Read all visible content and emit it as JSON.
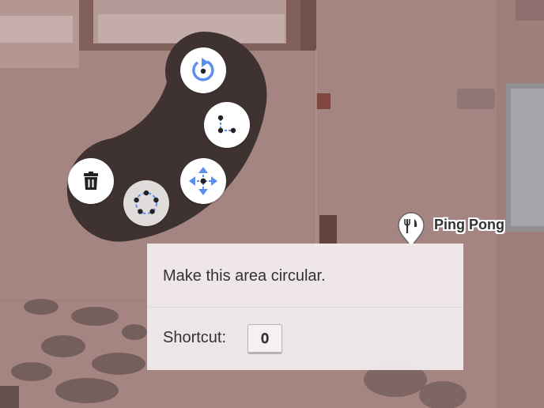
{
  "map": {
    "overlay_color": "#a68682",
    "poi": {
      "label": "Ping Pong",
      "icon": "restaurant-icon"
    }
  },
  "radial_menu": {
    "background_color": "#3e3331",
    "accent_color": "#5b8ff0",
    "items": [
      {
        "name": "rotate-button",
        "icon": "rotate-icon"
      },
      {
        "name": "disconnect-button",
        "icon": "disconnect-icon"
      },
      {
        "name": "move-button",
        "icon": "move-icon"
      },
      {
        "name": "circularize-button",
        "icon": "circularize-icon",
        "active": true
      },
      {
        "name": "delete-button",
        "icon": "delete-icon"
      }
    ]
  },
  "tooltip": {
    "description": "Make this area circular.",
    "shortcut_label": "Shortcut:",
    "shortcut_key": "O"
  }
}
